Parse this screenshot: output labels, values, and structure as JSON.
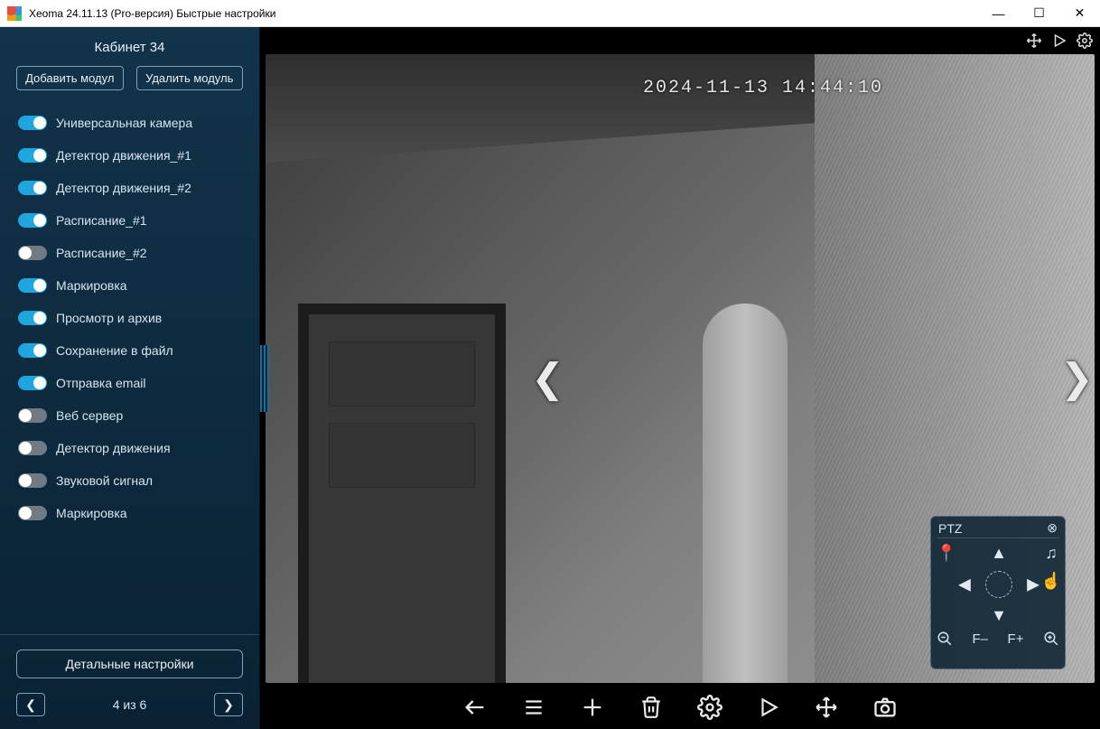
{
  "window": {
    "title": "Xeoma 24.11.13 (Pro-версия) Быстрые настройки"
  },
  "sidebar": {
    "cameraName": "Кабинет 34",
    "addModuleLabel": "Добавить модул",
    "deleteModuleLabel": "Удалить модуль",
    "detailSettingsLabel": "Детальные настройки",
    "pager": {
      "label": "4 из 6"
    },
    "modules": [
      {
        "label": "Универсальная камера",
        "on": true
      },
      {
        "label": "Детектор движения_#1",
        "on": true
      },
      {
        "label": "Детектор движения_#2",
        "on": true
      },
      {
        "label": "Расписание_#1",
        "on": true
      },
      {
        "label": "Расписание_#2",
        "on": false
      },
      {
        "label": "Маркировка",
        "on": true
      },
      {
        "label": "Просмотр и архив",
        "on": true
      },
      {
        "label": "Сохранение в файл",
        "on": true
      },
      {
        "label": "Отправка email",
        "on": true
      },
      {
        "label": "Веб сервер",
        "on": false
      },
      {
        "label": "Детектор движения",
        "on": false
      },
      {
        "label": "Звуковой сигнал",
        "on": false
      },
      {
        "label": "Маркировка",
        "on": false
      }
    ]
  },
  "video": {
    "timestamp": "2024-11-13 14:44:10"
  },
  "ptz": {
    "title": "PTZ",
    "focusMinus": "F–",
    "focusPlus": "F+"
  },
  "icons": {
    "topMove": "move-icon",
    "topPlay": "play-icon",
    "topSettings": "gear-icon",
    "barBack": "back-arrow-icon",
    "barMenu": "menu-icon",
    "barAdd": "plus-icon",
    "barTrash": "trash-icon",
    "barSettings": "gear-icon",
    "barPlay": "play-icon",
    "barMove": "move-icon",
    "barCamera": "camera-icon"
  }
}
